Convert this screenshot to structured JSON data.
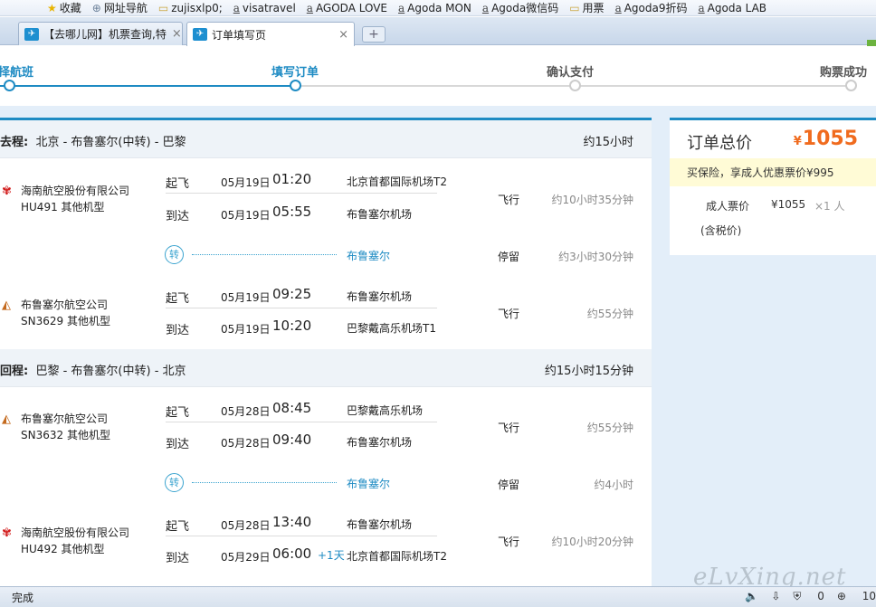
{
  "bookmarks": [
    {
      "icon": "star-icon",
      "label": "收藏"
    },
    {
      "icon": "globe-icon",
      "label": "网址导航"
    },
    {
      "icon": "folder-icon",
      "label": "zujisxlp0;"
    },
    {
      "icon": "a-icon",
      "label": "visatravel"
    },
    {
      "icon": "a-icon",
      "label": "AGODA LOVE"
    },
    {
      "icon": "a-icon",
      "label": "Agoda  MON"
    },
    {
      "icon": "a-icon",
      "label": "Agoda微信码"
    },
    {
      "icon": "folder-icon",
      "label": "用票"
    },
    {
      "icon": "a-icon",
      "label": "Agoda9折码"
    },
    {
      "icon": "a-icon",
      "label": "Agoda  LAB"
    }
  ],
  "tabs": [
    {
      "label": "【去哪儿网】机票查询,特",
      "close": "×"
    },
    {
      "label": "订单填写页",
      "close": "×"
    }
  ],
  "new_tab": "+",
  "steps": [
    "择航班",
    "填写订单",
    "确认支付",
    "购票成功"
  ],
  "outbound": {
    "prefix": "去程:",
    "route": "北京 - 布鲁塞尔(中转) - 巴黎",
    "duration": "约15小时",
    "leg1": {
      "airline": "海南航空股份有限公司",
      "code": "HU491 其他机型",
      "dep": {
        "label": "起飞",
        "date": "05月19日",
        "time": "01:20",
        "airport": "北京首都国际机场T2"
      },
      "arr": {
        "label": "到达",
        "date": "05月19日",
        "time": "05:55",
        "airport": "布鲁塞尔机场"
      },
      "kind": "飞行",
      "duration": "约10小时35分钟"
    },
    "transfer": {
      "icon": "转",
      "city": "布鲁塞尔",
      "kind": "停留",
      "duration": "约3小时30分钟"
    },
    "leg2": {
      "airline": "布鲁塞尔航空公司",
      "code": "SN3629 其他机型",
      "dep": {
        "label": "起飞",
        "date": "05月19日",
        "time": "09:25",
        "airport": "布鲁塞尔机场"
      },
      "arr": {
        "label": "到达",
        "date": "05月19日",
        "time": "10:20",
        "airport": "巴黎戴高乐机场T1"
      },
      "kind": "飞行",
      "duration": "约55分钟"
    }
  },
  "return": {
    "prefix": "回程:",
    "route": "巴黎 - 布鲁塞尔(中转) - 北京",
    "duration": "约15小时15分钟",
    "leg1": {
      "airline": "布鲁塞尔航空公司",
      "code": "SN3632 其他机型",
      "dep": {
        "label": "起飞",
        "date": "05月28日",
        "time": "08:45",
        "airport": "巴黎戴高乐机场"
      },
      "arr": {
        "label": "到达",
        "date": "05月28日",
        "time": "09:40",
        "airport": "布鲁塞尔机场"
      },
      "kind": "飞行",
      "duration": "约55分钟"
    },
    "transfer": {
      "icon": "转",
      "city": "布鲁塞尔",
      "kind": "停留",
      "duration": "约4小时"
    },
    "leg2": {
      "airline": "海南航空股份有限公司",
      "code": "HU492 其他机型",
      "dep": {
        "label": "起飞",
        "date": "05月28日",
        "time": "13:40",
        "airport": "布鲁塞尔机场"
      },
      "arr": {
        "label": "到达",
        "date": "05月29日",
        "time": "06:00",
        "plus": "+1天",
        "airport": "北京首都国际机场T2"
      },
      "kind": "飞行",
      "duration": "约10小时20分钟"
    }
  },
  "price": {
    "title": "订单总价",
    "currency": "¥",
    "total": "1055",
    "promo": "买保险，享成人优惠票价¥995",
    "adult_label": "成人票价",
    "adult_price": "¥1055",
    "adult_qty": "×1 人",
    "tax_note": "(含税价)"
  },
  "status": {
    "text": "完成",
    "right": [
      "0",
      "10"
    ]
  },
  "watermark": "eLvXing.net",
  "colors": {
    "accent": "#1e8bc3",
    "price": "#f06b1e",
    "promo_bg": "#fffbd6"
  }
}
